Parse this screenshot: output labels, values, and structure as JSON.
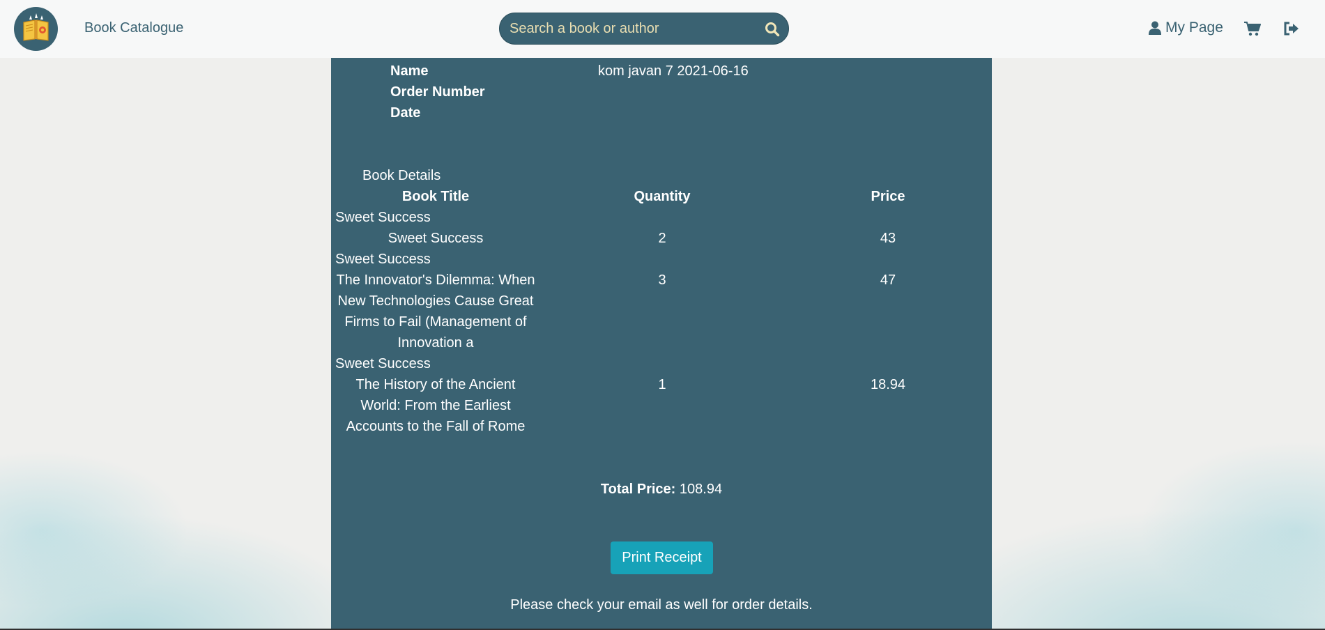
{
  "navbar": {
    "brand": "Book Catalogue",
    "search_placeholder": "Search a book or author",
    "my_page_label": "My Page"
  },
  "receipt": {
    "labels": {
      "name": "Name",
      "order_number": "Order Number",
      "date": "Date"
    },
    "name_value": "kom javan 7 2021-06-16",
    "book_details_heading": "Book Details",
    "columns": {
      "title": "Book Title",
      "quantity": "Quantity",
      "price": "Price"
    },
    "items": [
      {
        "store": "Sweet Success",
        "title_lines": [
          "Sweet Success"
        ],
        "quantity": "2",
        "price": "43"
      },
      {
        "store": "Sweet Success",
        "title_lines": [
          "The Innovator's Dilemma: When",
          "New Technologies Cause Great",
          "Firms to Fail (Management of",
          "Innovation a"
        ],
        "quantity": "3",
        "price": "47"
      },
      {
        "store": "Sweet Success",
        "title_lines": [
          "The History of the Ancient",
          "World: From the Earliest",
          "Accounts to the Fall of Rome"
        ],
        "quantity": "1",
        "price": "18.94"
      }
    ],
    "total_label": "Total Price:",
    "total_value": "108.94",
    "print_button": "Print Receipt",
    "email_note": "Please check your email as well for order details."
  },
  "colors": {
    "primary": "#3a6272",
    "button": "#17a2b8",
    "search_text": "#e9deb1"
  }
}
